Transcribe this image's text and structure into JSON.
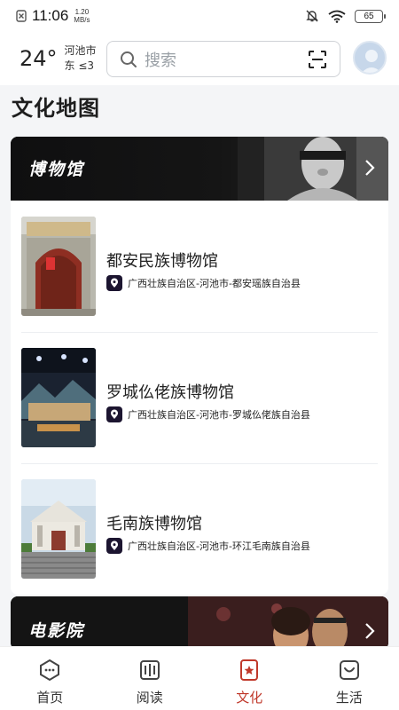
{
  "status_bar": {
    "time": "11:06",
    "speed_value": "1.20",
    "speed_unit": "MB/s",
    "battery": "65"
  },
  "header": {
    "temperature": "24°",
    "city": "河池市",
    "wind": "东  ≤3",
    "search_placeholder": "搜索"
  },
  "page_title": "文化地图",
  "museum_section": {
    "title": "博物馆",
    "items": [
      {
        "name": "都安民族博物馆",
        "address": "广西壮族自治区-河池市-都安瑶族自治县"
      },
      {
        "name": "罗城仫佬族博物馆",
        "address": "广西壮族自治区-河池市-罗城仫佬族自治县"
      },
      {
        "name": "毛南族博物馆",
        "address": "广西壮族自治区-河池市-环江毛南族自治县"
      }
    ]
  },
  "cinema_section": {
    "title": "电影院"
  },
  "bottom_nav": {
    "items": [
      {
        "label": "首页",
        "icon": "home-icon",
        "active": false
      },
      {
        "label": "阅读",
        "icon": "book-icon",
        "active": false
      },
      {
        "label": "文化",
        "icon": "culture-icon",
        "active": true
      },
      {
        "label": "生活",
        "icon": "life-icon",
        "active": false
      }
    ]
  },
  "colors": {
    "accent": "#c0392b",
    "pin_badge": "#1c1530",
    "header_bg": "#0f0f10"
  }
}
